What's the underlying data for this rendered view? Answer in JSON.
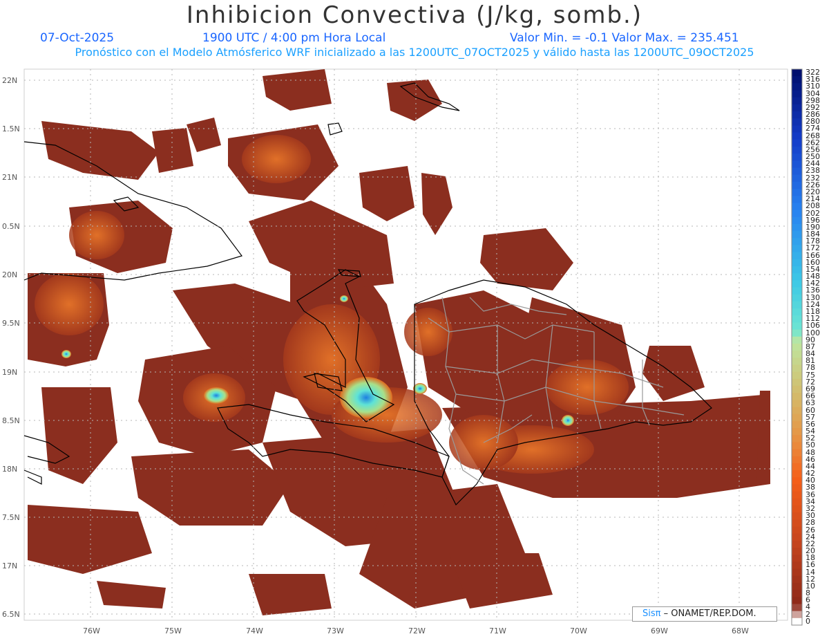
{
  "title": "Inhibicion Convectiva (J/kg, somb.)",
  "header": {
    "date": "07-Oct-2025",
    "time": "1900 UTC / 4:00 pm Hora Local",
    "minmax": "Valor Min. = -0.1  Valor Max. = 235.451",
    "model_line": "Pronóstico con el Modelo Atmósferico WRF inicializado a las 1200UTC_07OCT2025 y válido hasta las  1200UTC_09OCT2025"
  },
  "axes": {
    "lat_labels": [
      "22N",
      "1.5N",
      "21N",
      "0.5N",
      "20N",
      "9.5N",
      "19N",
      "8.5N",
      "18N",
      "7.5N",
      "17N",
      "6.5N"
    ],
    "lon_labels": [
      "76W",
      "75W",
      "74W",
      "73W",
      "72W",
      "71W",
      "70W",
      "69W",
      "68W"
    ]
  },
  "colorbar": {
    "labels": [
      "322",
      "316",
      "310",
      "304",
      "298",
      "292",
      "286",
      "280",
      "274",
      "268",
      "262",
      "256",
      "250",
      "244",
      "238",
      "232",
      "226",
      "220",
      "214",
      "208",
      "202",
      "196",
      "190",
      "184",
      "178",
      "172",
      "166",
      "160",
      "154",
      "148",
      "142",
      "136",
      "130",
      "124",
      "118",
      "112",
      "106",
      "100",
      "90",
      "87",
      "84",
      "81",
      "78",
      "75",
      "72",
      "69",
      "66",
      "63",
      "60",
      "57",
      "56",
      "54",
      "52",
      "50",
      "48",
      "46",
      "44",
      "42",
      "40",
      "38",
      "36",
      "34",
      "32",
      "30",
      "28",
      "26",
      "24",
      "22",
      "20",
      "18",
      "16",
      "14",
      "12",
      "10",
      "8",
      "6",
      "4",
      "2",
      "0"
    ]
  },
  "credit": {
    "brand": "Sisπ",
    "text": "– ONAMET/REP.DOM."
  },
  "colors": {
    "low": "#8b2e1f",
    "mid": "#e8561a",
    "high": "#1a4fc8",
    "border_country": "#000000",
    "border_province": "#9a9a9a"
  }
}
